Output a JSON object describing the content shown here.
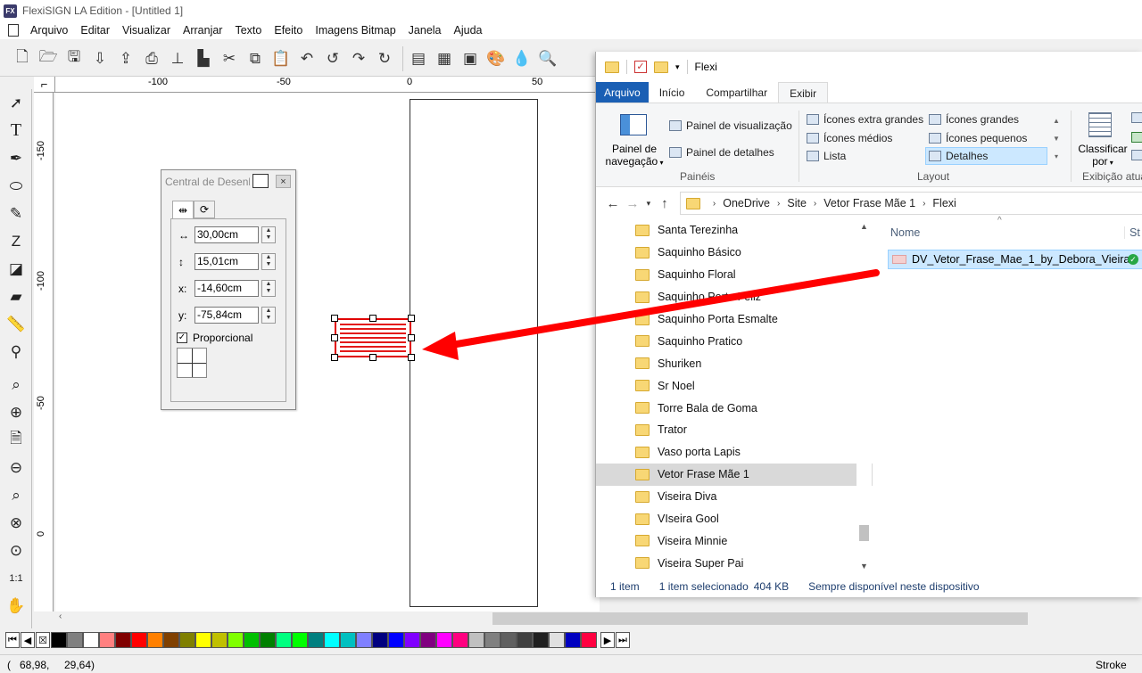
{
  "app": {
    "title": "FlexiSIGN LA Edition - [Untitled 1]",
    "icon_text": "FX",
    "menu": [
      "Arquivo",
      "Editar",
      "Visualizar",
      "Arranjar",
      "Texto",
      "Efeito",
      "Imagens Bitmap",
      "Janela",
      "Ajuda"
    ]
  },
  "rulers": {
    "horizontal": [
      "-100",
      "-50",
      "0",
      "50"
    ],
    "vertical": [
      "-150",
      "-100",
      "-50",
      "0"
    ]
  },
  "central": {
    "title": "Central de Desenho",
    "close": "×",
    "tab1_icon": "⇹",
    "tab2_icon": "⟳",
    "width_label": "↔",
    "width_value": "30,00cm",
    "height_label": "↕",
    "height_value": "15,01cm",
    "x_label": "x:",
    "x_value": "-14,60cm",
    "y_label": "y:",
    "y_value": "-75,84cm",
    "check_mark": "✓",
    "proportional_label": "Proporcional"
  },
  "status": {
    "coord_x": "68,98,",
    "coord_y": "29,64)",
    "coord_prefix": "(",
    "mode": "Stroke"
  },
  "palette_colors": [
    "#000000",
    "#808080",
    "#ffffff",
    "#ff8080",
    "#800000",
    "#ff0000",
    "#ff8000",
    "#804000",
    "#808000",
    "#ffff00",
    "#c0c000",
    "#80ff00",
    "#00c000",
    "#008000",
    "#00ff80",
    "#00ff00",
    "#008080",
    "#00ffff",
    "#00c0c0",
    "#8080ff",
    "#000080",
    "#0000ff",
    "#8000ff",
    "#800080",
    "#ff00ff",
    "#ff0080",
    "#c0c0c0",
    "#808080",
    "#606060",
    "#404040",
    "#202020",
    "#e0e0e0",
    "#0000c0",
    "#ff0040"
  ],
  "explorer": {
    "title": "Flexi",
    "tabs": {
      "file": "Arquivo",
      "home": "Início",
      "share": "Compartilhar",
      "view": "Exibir"
    },
    "ribbon": {
      "nav_pane": "Painel de navegação",
      "nav_pane_line1": "Painel de",
      "nav_pane_line2": "navegação",
      "preview_pane": "Painel de visualização",
      "details_pane": "Painel de detalhes",
      "panes_group": "Painéis",
      "layout": {
        "extra_large": "Ícones extra grandes",
        "large": "Ícones grandes",
        "medium": "Ícones médios",
        "small": "Ícones pequenos",
        "list": "Lista",
        "details": "Detalhes"
      },
      "layout_group": "Layout",
      "sort_line1": "Classificar",
      "sort_line2": "por",
      "current_view_group": "Exibição atua"
    },
    "breadcrumb": [
      "OneDrive",
      "Site",
      "Vetor Frase Mãe 1",
      "Flexi"
    ],
    "folders": [
      "Santa Terezinha",
      "Saquinho Básico",
      "Saquinho Floral",
      "Saquinho Porta Feliz",
      "Saquinho Porta Esmalte",
      "Saquinho Pratico",
      "Shuriken",
      "Sr Noel",
      "Torre Bala de Goma",
      "Trator",
      "Vaso porta Lapis",
      "Vetor Frase Mãe 1",
      "Viseira Diva",
      "VIseira Gool",
      "Viseira Minnie",
      "Viseira Super Pai"
    ],
    "selected_folder": "Vetor Frase Mãe 1",
    "column_name": "Nome",
    "column_status": "St",
    "file": "DV_Vetor_Frase_Mae_1_by_Debora_Vieira",
    "status": {
      "count": "1 item",
      "selected": "1 item selecionado",
      "size": "404 KB",
      "availability": "Sempre disponível neste dispositivo"
    }
  },
  "colors": {
    "accent_blue": "#1a5fb4",
    "selection_red": "#e00000",
    "arrow_red": "#ff0000"
  }
}
